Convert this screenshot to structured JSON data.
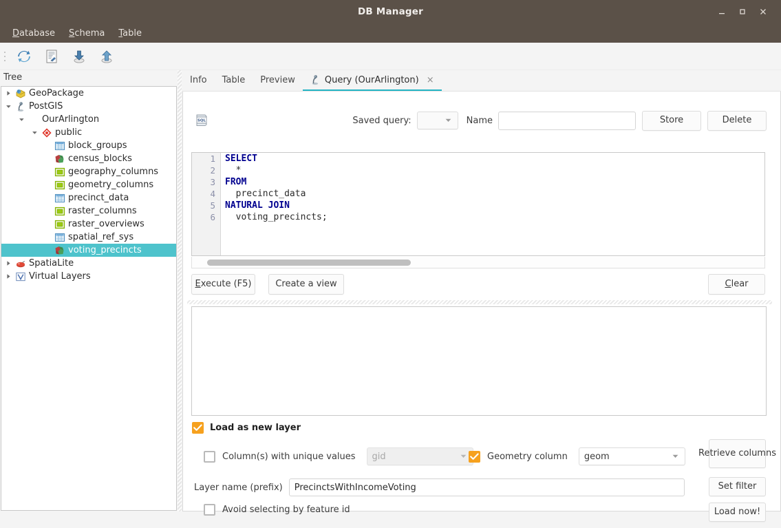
{
  "window": {
    "title": "DB Manager",
    "minimize_label": "minimize",
    "maximize_label": "maximize",
    "close_label": "close"
  },
  "menubar": {
    "items": [
      {
        "label": "Database",
        "mnemonic": "D",
        "rest": "atabase"
      },
      {
        "label": "Schema",
        "mnemonic": "S",
        "rest": "chema"
      },
      {
        "label": "Table",
        "mnemonic": "T",
        "rest": "able"
      }
    ]
  },
  "toolbar": {
    "buttons": [
      {
        "name": "refresh-icon",
        "tooltip": "Refresh"
      },
      {
        "name": "sql-window-icon",
        "tooltip": "SQL Window"
      },
      {
        "name": "import-layer-icon",
        "tooltip": "Import layer/file"
      },
      {
        "name": "export-layer-icon",
        "tooltip": "Export to file"
      }
    ]
  },
  "tree": {
    "title": "Tree",
    "nodes": [
      {
        "label": "GeoPackage",
        "indent": 0,
        "arrow": "right",
        "icon": "geopackage-icon",
        "selected": false
      },
      {
        "label": "PostGIS",
        "indent": 0,
        "arrow": "down",
        "icon": "postgis-icon",
        "selected": false
      },
      {
        "label": "OurArlington",
        "indent": 1,
        "arrow": "down",
        "icon": "none",
        "selected": false
      },
      {
        "label": "public",
        "indent": 2,
        "arrow": "down",
        "icon": "schema-icon",
        "selected": false
      },
      {
        "label": "block_groups",
        "indent": 3,
        "arrow": "none",
        "icon": "table-icon",
        "selected": false
      },
      {
        "label": "census_blocks",
        "indent": 3,
        "arrow": "none",
        "icon": "vector-layer-icon",
        "selected": false
      },
      {
        "label": "geography_columns",
        "indent": 3,
        "arrow": "none",
        "icon": "view-icon",
        "selected": false
      },
      {
        "label": "geometry_columns",
        "indent": 3,
        "arrow": "none",
        "icon": "view-icon",
        "selected": false
      },
      {
        "label": "precinct_data",
        "indent": 3,
        "arrow": "none",
        "icon": "table-icon",
        "selected": false
      },
      {
        "label": "raster_columns",
        "indent": 3,
        "arrow": "none",
        "icon": "view-icon",
        "selected": false
      },
      {
        "label": "raster_overviews",
        "indent": 3,
        "arrow": "none",
        "icon": "view-icon",
        "selected": false
      },
      {
        "label": "spatial_ref_sys",
        "indent": 3,
        "arrow": "none",
        "icon": "table-icon",
        "selected": false
      },
      {
        "label": "voting_precincts",
        "indent": 3,
        "arrow": "none",
        "icon": "vector-layer-icon",
        "selected": true
      },
      {
        "label": "SpatiaLite",
        "indent": 0,
        "arrow": "right",
        "icon": "spatialite-icon",
        "selected": false
      },
      {
        "label": "Virtual Layers",
        "indent": 0,
        "arrow": "right",
        "icon": "virtual-layer-icon",
        "selected": false
      }
    ]
  },
  "tabs": [
    {
      "label": "Info",
      "active": false,
      "closable": false,
      "icon": "none"
    },
    {
      "label": "Table",
      "active": false,
      "closable": false,
      "icon": "none"
    },
    {
      "label": "Preview",
      "active": false,
      "closable": false,
      "icon": "none"
    },
    {
      "label": "Query (OurArlington)",
      "active": true,
      "closable": true,
      "icon": "postgis-icon",
      "close_label": "×"
    }
  ],
  "query_header": {
    "sql_icon": "sql-file-icon",
    "saved_query_label": "Saved query:",
    "saved_query_value": "",
    "name_label": "Name",
    "name_value": "",
    "name_placeholder": "",
    "store_label": "Store",
    "delete_label": "Delete"
  },
  "editor": {
    "lines": [
      {
        "num": "1",
        "tokens": [
          {
            "t": "SELECT",
            "kw": true
          }
        ]
      },
      {
        "num": "2",
        "tokens": [
          {
            "t": "  *",
            "kw": false
          }
        ]
      },
      {
        "num": "3",
        "tokens": [
          {
            "t": "FROM",
            "kw": true
          }
        ]
      },
      {
        "num": "4",
        "tokens": [
          {
            "t": "  precinct_data",
            "kw": false
          }
        ]
      },
      {
        "num": "5",
        "tokens": [
          {
            "t": "NATURAL JOIN",
            "kw": true
          }
        ]
      },
      {
        "num": "6",
        "tokens": [
          {
            "t": "  voting_precincts;",
            "kw": false
          }
        ]
      }
    ],
    "full_sql": "SELECT\n  *\nFROM\n  precinct_data\nNATURAL JOIN\n  voting_precincts;"
  },
  "action_buttons": {
    "execute_mnemonic": "E",
    "execute_rest": "xecute (F5)",
    "execute_label": "Execute (F5)",
    "create_view_label": "Create a view",
    "clear_mnemonic": "C",
    "clear_rest": "lear",
    "clear_label": "Clear"
  },
  "load_options": {
    "load_as_new_layer_label": "Load as new layer",
    "load_as_new_layer_checked": true,
    "unique_values_label": "Column(s) with unique values",
    "unique_values_checked": false,
    "unique_values_combo": "gid",
    "unique_values_enabled": false,
    "geometry_column_label": "Geometry column",
    "geometry_column_checked": true,
    "geometry_column_value": "geom",
    "retrieve_columns_label": "Retrieve columns",
    "layer_name_label": "Layer name (prefix)",
    "layer_name_value": "PrecinctsWithIncomeVoting",
    "set_filter_label": "Set filter",
    "avoid_feature_id_label": "Avoid selecting by feature id",
    "avoid_feature_id_checked": false,
    "load_now_label": "Load now!"
  },
  "colors": {
    "titlebar": "#5b5148",
    "selection": "#4ec3cc",
    "accent_checkbox": "#f6a11e",
    "tab_underline": "#22b4c4",
    "sql_keyword": "#00008f"
  }
}
